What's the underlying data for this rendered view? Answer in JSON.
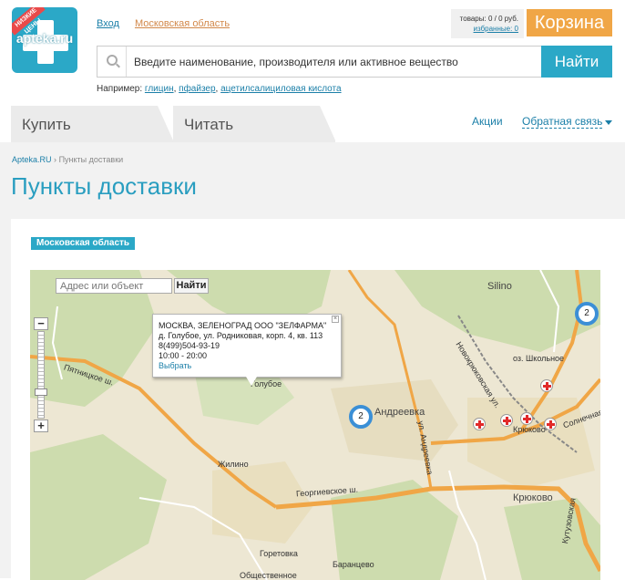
{
  "header": {
    "logo": {
      "brand": "apteka.ru",
      "ribbon": "НИЗКИЕ ЦЕНЫ"
    },
    "login_label": "Вход",
    "region_label": "Московская область",
    "cart_summary": "товары: 0 / 0 руб.",
    "favorites_label": "избранные: 0",
    "cart_button": "Корзина",
    "search_placeholder": "Введите наименование, производителя или активное вещество",
    "search_button": "Найти",
    "examples_prefix": "Например:",
    "examples": [
      "глицин",
      "пфайзер",
      "ацетилсалициловая кислота"
    ]
  },
  "nav": {
    "tab_buy": "Купить",
    "tab_read": "Читать",
    "sales": "Акции",
    "feedback": "Обратная связь"
  },
  "page": {
    "breadcrumb_root": "Apteka.RU",
    "breadcrumb_sep": "›",
    "breadcrumb_current": "Пункты доставки",
    "title": "Пункты доставки",
    "region_tag": "Московская область"
  },
  "map": {
    "search_placeholder": "Адрес или объект",
    "search_button": "Найти",
    "zoom_in": "+",
    "zoom_out": "−",
    "balloon": {
      "title": "МОСКВА, ЗЕЛЕНОГРАД ООО \"ЗЕЛФАРМА\"",
      "address": "д. Голубое, ул. Родниковая, корп. 4, кв. 113",
      "phone": "8(499)504-93-19",
      "hours": "10:00 - 20:00",
      "select": "Выбрать",
      "close": "×"
    },
    "clusters": [
      "2",
      "2"
    ],
    "labels": {
      "silino": "Silino",
      "andreevka": "Андреевка",
      "golubnoe": "Голубое",
      "zhilino": "Жилино",
      "kryukovo": "Крюково",
      "kryukovo_station": "Крюково",
      "goretovka": "Горетовка",
      "barantsevo": "Баранцево",
      "obshestvo": "Общественное",
      "pyatnitskoe": "Пятницкое ш.",
      "georgievskoe": "Георгиевское ш.",
      "andreevka_st": "ул. Андреевка",
      "novokryukovskaya": "Новокрюковская ул.",
      "school_lake": "оз. Школьное",
      "solnechnaya": "Солнечная",
      "kutuzovskaya": "Кутузовская"
    }
  }
}
